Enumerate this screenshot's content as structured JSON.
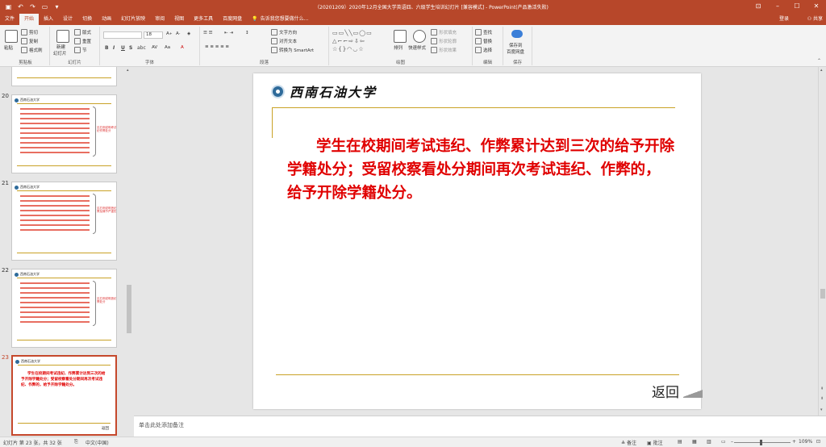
{
  "titlebar": {
    "title": "（20201209）2020年12月全国大学英语四、六级学生培训幻灯片 [兼容模式] - PowerPoint(产品激活失败)",
    "save_icon": "save-icon",
    "undo_icon": "undo-icon",
    "redo_icon": "redo-icon",
    "customize_icon": "customize-qat-icon"
  },
  "tabs": [
    "文件",
    "开始",
    "插入",
    "设计",
    "切换",
    "动画",
    "幻灯片放映",
    "审阅",
    "视图",
    "更多工具",
    "百度网盘"
  ],
  "active_tab": "开始",
  "search_hint": "告诉我您想要做什么...",
  "account": {
    "login": "登录",
    "share": "共享"
  },
  "ribbon": {
    "clipboard": {
      "paste": "粘贴",
      "cut": "剪切",
      "copy": "复制",
      "format_painter": "格式刷",
      "label": "剪贴板"
    },
    "slides": {
      "new_slide": "新建",
      "new_slide2": "幻灯片",
      "layout": "版式",
      "reset": "重置",
      "section": "节",
      "label": "幻灯片"
    },
    "font": {
      "size": "18",
      "label": "字体",
      "bold": "B",
      "italic": "I",
      "underline": "U",
      "strike": "S",
      "abc": "abc"
    },
    "paragraph": {
      "text_direction": "文字方向",
      "align_text": "对齐文本",
      "smartart": "转换为 SmartArt",
      "label": "段落"
    },
    "drawing": {
      "arrange": "排列",
      "quick_styles": "快速样式",
      "shape_fill": "形状填充",
      "shape_outline": "形状轮廓",
      "shape_effects": "形状效果",
      "label": "绘图"
    },
    "editing": {
      "find": "查找",
      "replace": "替换",
      "select": "选择",
      "label": "编辑"
    },
    "save": {
      "save_to": "保存到",
      "baidu": "百度网盘",
      "label": "保存"
    }
  },
  "slides_panel": {
    "items": [
      {
        "number": "20",
        "brace_text": "见右侧说明考试违纪作弊处分"
      },
      {
        "number": "21",
        "brace_text": "见右侧说明违纪作弊及情节严重的"
      },
      {
        "number": "22",
        "brace_text": "见右侧说明违纪作弊处分"
      },
      {
        "number": "23",
        "text": "学生在校期间考试违纪、作弊累计达到三次的给予开除学籍处分；受留校察看处分期间再次考试违纪、作弊的，给予开除学籍处分。",
        "footer": "返回"
      }
    ],
    "thumb_school": "西南石油大学"
  },
  "slide": {
    "school_name": "西南石油大学",
    "body": "学生在校期间考试违纪、作弊累计达到三次的给予开除学籍处分；受留校察看处分期间再次考试违纪、作弊的，给予开除学籍处分。",
    "return_label": "返回"
  },
  "notes_placeholder": "单击此处添加备注",
  "status": {
    "slide_info": "幻灯片 第 23 张，共 32 张",
    "language": "中文(中国)",
    "notes": "备注",
    "comments": "批注",
    "zoom": "109%"
  }
}
